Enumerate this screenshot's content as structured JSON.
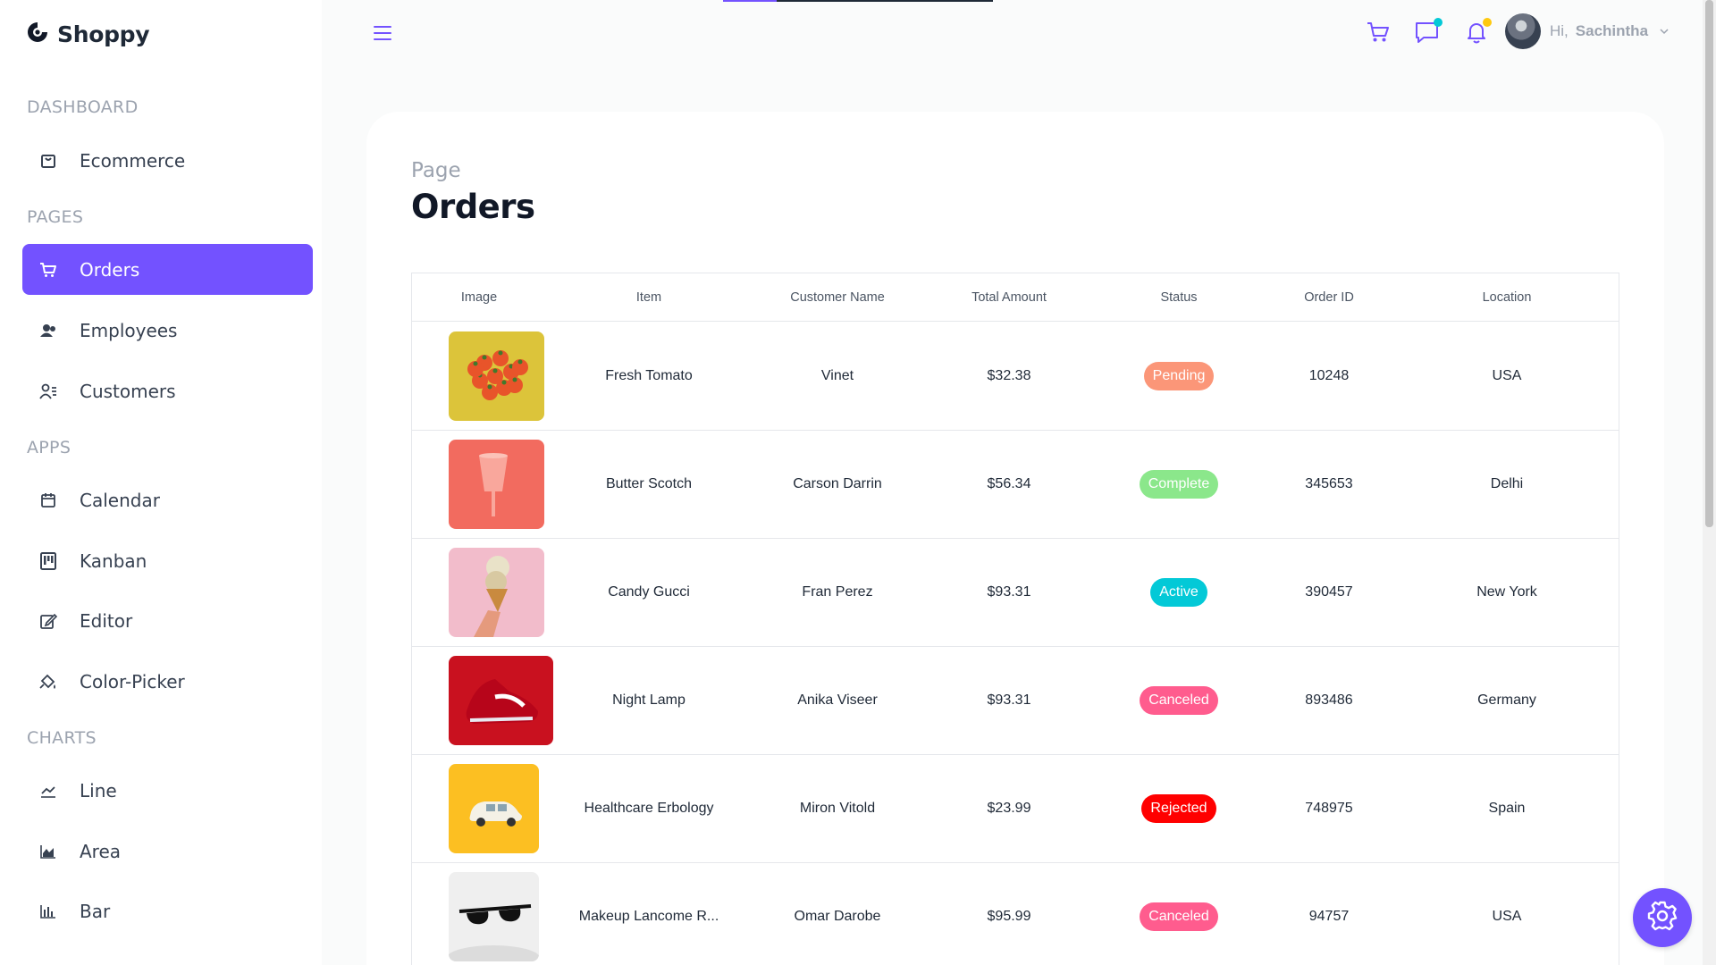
{
  "app": {
    "name": "Shoppy"
  },
  "sidebar": {
    "sections": [
      {
        "title": "Dashboard",
        "items": [
          {
            "label": "Ecommerce",
            "icon": "shopping-bag-icon",
            "active": false
          }
        ]
      },
      {
        "title": "Pages",
        "items": [
          {
            "label": "Orders",
            "icon": "cart-icon",
            "active": true
          },
          {
            "label": "Employees",
            "icon": "employees-icon",
            "active": false
          },
          {
            "label": "Customers",
            "icon": "customers-icon",
            "active": false
          }
        ]
      },
      {
        "title": "Apps",
        "items": [
          {
            "label": "Calendar",
            "icon": "calendar-icon",
            "active": false
          },
          {
            "label": "Kanban",
            "icon": "kanban-icon",
            "active": false
          },
          {
            "label": "Editor",
            "icon": "editor-icon",
            "active": false
          },
          {
            "label": "Color-Picker",
            "icon": "color-picker-icon",
            "active": false
          }
        ]
      },
      {
        "title": "Charts",
        "items": [
          {
            "label": "Line",
            "icon": "line-chart-icon",
            "active": false
          },
          {
            "label": "Area",
            "icon": "area-chart-icon",
            "active": false
          },
          {
            "label": "Bar",
            "icon": "bar-chart-icon",
            "active": false
          }
        ]
      }
    ]
  },
  "header": {
    "menu_icon": "hamburger-menu-icon",
    "cart_icon": "cart-icon",
    "chat_icon": "chat-icon",
    "notification_icon": "bell-icon",
    "chat_dot_color": "#03c9d7",
    "notification_dot_color": "#fec90f",
    "greeting": "Hi,",
    "user_name": "Sachintha"
  },
  "page": {
    "subtitle": "Page",
    "title": "Orders"
  },
  "table": {
    "columns": [
      "Image",
      "Item",
      "Customer Name",
      "Total Amount",
      "Status",
      "Order ID",
      "Location"
    ],
    "rows": [
      {
        "image": "tomatoes-photo",
        "item": "Fresh Tomato",
        "customer": "Vinet",
        "amount": "$32.38",
        "status": "Pending",
        "status_color": "#fb9678",
        "order_id": "10248",
        "location": "USA"
      },
      {
        "image": "pink-glass-photo",
        "item": "Butter Scotch",
        "customer": "Carson Darrin",
        "amount": "$56.34",
        "status": "Complete",
        "status_color": "#8be78b",
        "order_id": "345653",
        "location": "Delhi"
      },
      {
        "image": "ice-cream-photo",
        "item": "Candy Gucci",
        "customer": "Fran Perez",
        "amount": "$93.31",
        "status": "Active",
        "status_color": "#03c9d7",
        "order_id": "390457",
        "location": "New York"
      },
      {
        "image": "red-sneaker-photo",
        "item": "Night Lamp",
        "customer": "Anika Viseer",
        "amount": "$93.31",
        "status": "Canceled",
        "status_color": "#ff5c8e",
        "order_id": "893486",
        "location": "Germany"
      },
      {
        "image": "toy-car-photo",
        "item": "Healthcare Erbology",
        "customer": "Miron Vitold",
        "amount": "$23.99",
        "status": "Rejected",
        "status_color": "#ff0000",
        "order_id": "748975",
        "location": "Spain"
      },
      {
        "image": "sunglasses-photo",
        "item": "Makeup Lancome R...",
        "customer": "Omar Darobe",
        "amount": "$95.99",
        "status": "Canceled",
        "status_color": "#ff5c8e",
        "order_id": "94757",
        "location": "USA"
      }
    ]
  },
  "settings_button": {
    "icon": "gear-icon",
    "color": "#7352ff"
  },
  "colors": {
    "accent": "#7352ff"
  }
}
